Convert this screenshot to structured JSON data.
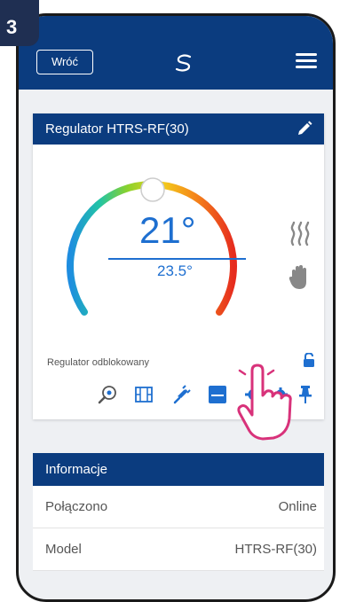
{
  "step": {
    "number": "3"
  },
  "header": {
    "back_label": "Wróć",
    "brand_color": "#0b3c7f"
  },
  "regulator": {
    "title": "Regulator HTRS-RF(30)",
    "current_temp": "21°",
    "set_temp": "23.5°",
    "status": "Regulator odblokowany",
    "mode_icons": [
      "heating-icon",
      "manual-mode-hand-icon"
    ],
    "toolbar_icons": [
      "search-icon",
      "schedule-icon",
      "plug-icon",
      "display-icon",
      "settings-icon",
      "gear-icon",
      "pin-icon"
    ]
  },
  "info": {
    "header": "Informacje",
    "rows": [
      {
        "label": "Połączono",
        "value": "Online"
      },
      {
        "label": "Model",
        "value": "HTRS-RF(30)"
      }
    ]
  }
}
